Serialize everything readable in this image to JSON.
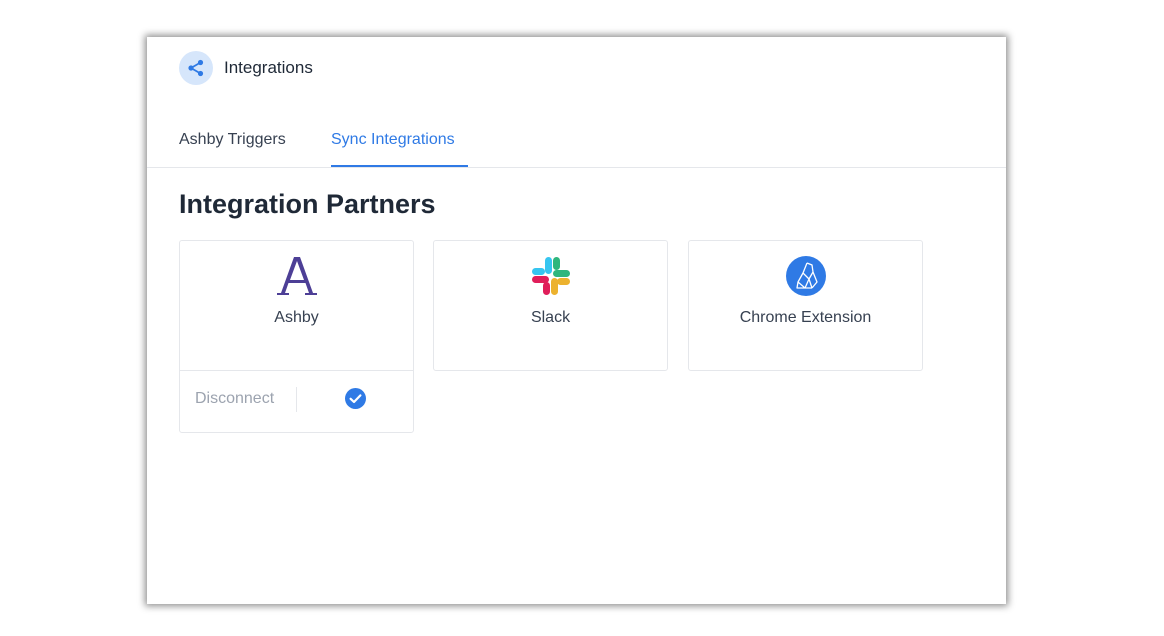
{
  "header": {
    "title": "Integrations",
    "icon": "share-icon"
  },
  "tabs": [
    {
      "label": "Ashby Triggers",
      "active": false
    },
    {
      "label": "Sync Integrations",
      "active": true
    }
  ],
  "section": {
    "title": "Integration Partners"
  },
  "cards": [
    {
      "name": "Ashby",
      "logo": "ashby-logo-icon",
      "status": "connected",
      "disconnect_label": "Disconnect"
    },
    {
      "name": "Slack",
      "logo": "slack-logo-icon"
    },
    {
      "name": "Chrome Extension",
      "logo": "chrome-extension-logo-icon"
    }
  ],
  "colors": {
    "accent": "#2f7ae5",
    "icon_bg": "#d6e6fb",
    "ashby_purple": "#4d3f96",
    "text_dark": "#1f2937",
    "text_muted": "#9ca3af",
    "border": "#e5e7eb"
  }
}
